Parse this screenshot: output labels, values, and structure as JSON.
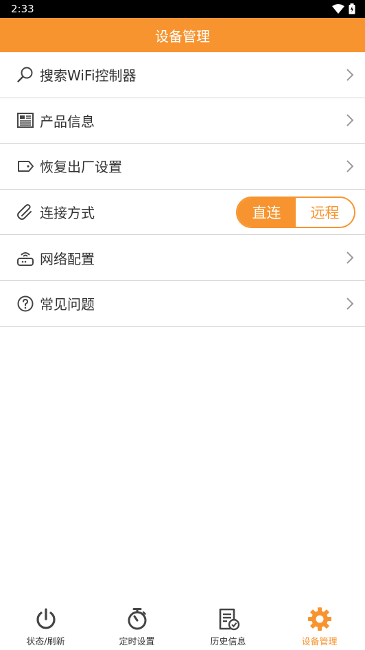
{
  "status_bar": {
    "time": "2:33"
  },
  "app_bar": {
    "title": "设备管理"
  },
  "menu": {
    "items": [
      {
        "label": "搜索WiFi控制器",
        "icon": "search-icon"
      },
      {
        "label": "产品信息",
        "icon": "newspaper-icon"
      },
      {
        "label": "恢复出厂设置",
        "icon": "tag-icon"
      },
      {
        "label": "连接方式",
        "icon": "paperclip-icon"
      },
      {
        "label": "网络配置",
        "icon": "router-icon"
      },
      {
        "label": "常见问题",
        "icon": "question-icon"
      }
    ],
    "connection_toggle": {
      "direct": "直连",
      "remote": "远程",
      "selected": "直连"
    }
  },
  "bottom_nav": {
    "items": [
      {
        "label": "状态/刷新",
        "icon": "power-icon"
      },
      {
        "label": "定时设置",
        "icon": "stopwatch-icon"
      },
      {
        "label": "历史信息",
        "icon": "history-doc-icon"
      },
      {
        "label": "设备管理",
        "icon": "gear-icon"
      }
    ],
    "active_index": 3
  },
  "colors": {
    "accent": "#f7942f",
    "text": "#333333",
    "divider": "#d5d5d5"
  }
}
